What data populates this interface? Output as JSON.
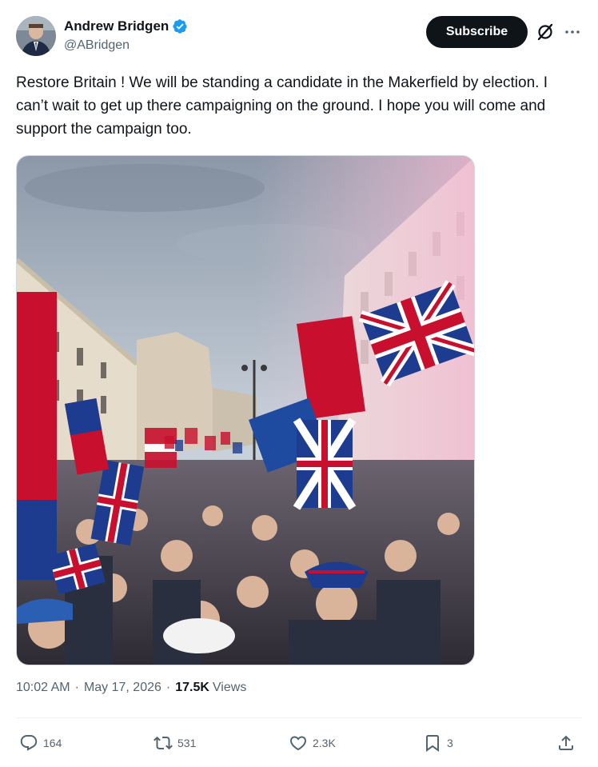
{
  "author": {
    "display_name": "Andrew Bridgen",
    "handle": "@ABridgen",
    "verified": true
  },
  "header": {
    "subscribe_label": "Subscribe"
  },
  "tweet": {
    "text": "Restore Britain ! We will be standing a candidate in the Makerfield by election. I can’t wait to get up there campaigning on the ground. I hope you will come and support the campaign too."
  },
  "meta": {
    "time": "10:02 AM",
    "date": "May 17, 2026",
    "views_count": "17.5K",
    "views_label": "Views"
  },
  "actions": {
    "replies": "164",
    "reposts": "531",
    "likes": "2.3K",
    "bookmarks": "3"
  },
  "colors": {
    "verified_blue": "#1d9bf0",
    "text_primary": "#0f1419",
    "text_secondary": "#536471",
    "subscribe_bg": "#0f1419"
  },
  "icons": [
    "verified-badge-icon",
    "grok-icon",
    "more-icon",
    "reply-icon",
    "repost-icon",
    "like-icon",
    "bookmark-icon",
    "share-icon"
  ]
}
